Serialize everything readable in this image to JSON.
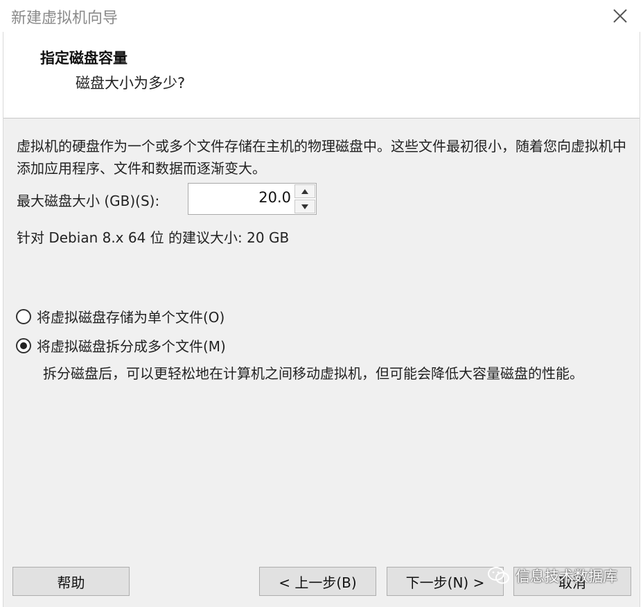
{
  "window": {
    "title": "新建虚拟机向导"
  },
  "header": {
    "title": "指定磁盘容量",
    "subtitle": "磁盘大小为多少?"
  },
  "body": {
    "description": "虚拟机的硬盘作为一个或多个文件存储在主机的物理磁盘中。这些文件最初很小，随着您向虚拟机中添加应用程序、文件和数据而逐渐变大。",
    "max_size_label": "最大磁盘大小 (GB)(S):",
    "max_size_value": "20.0",
    "recommended": "针对 Debian 8.x 64 位 的建议大小: 20 GB",
    "options": [
      {
        "label": "将虚拟磁盘存储为单个文件(O)",
        "selected": false
      },
      {
        "label": "将虚拟磁盘拆分成多个文件(M)",
        "selected": true
      }
    ],
    "split_description": "拆分磁盘后，可以更轻松地在计算机之间移动虚拟机，但可能会降低大容量磁盘的性能。"
  },
  "buttons": {
    "help": "帮助",
    "back": "< 上一步(B)",
    "next": "下一步(N) >",
    "cancel": "取消"
  },
  "watermark": {
    "text": "信息技术数据库"
  },
  "icons": {
    "close": "close-icon",
    "spin_up": "arrow-up-icon",
    "spin_down": "arrow-down-icon",
    "wechat": "wechat-icon"
  }
}
